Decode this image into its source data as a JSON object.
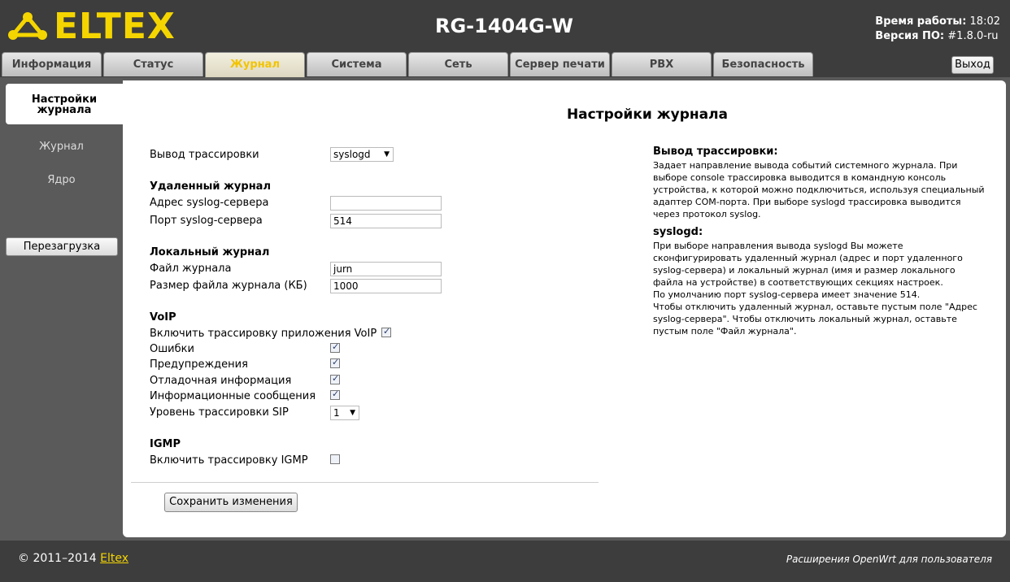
{
  "header": {
    "brand": "ELTEX",
    "device": "RG-1404G-W",
    "uptime_label": "Время работы:",
    "uptime_value": "18:02",
    "firmware_label": "Версия ПО:",
    "firmware_value": "#1.8.0-ru"
  },
  "tabs": [
    {
      "label": "Информация"
    },
    {
      "label": "Статус"
    },
    {
      "label": "Журнал",
      "active": true
    },
    {
      "label": "Система"
    },
    {
      "label": "Сеть"
    },
    {
      "label": "Сервер печати"
    },
    {
      "label": "PBX"
    },
    {
      "label": "Безопасность"
    }
  ],
  "logout_label": "Выход",
  "sidebar": {
    "items": [
      {
        "label": "Настройки журнала",
        "active": true
      },
      {
        "label": "Журнал"
      },
      {
        "label": "Ядро"
      }
    ],
    "reboot_label": "Перезагрузка"
  },
  "page_title": "Настройки журнала",
  "form": {
    "trace_output_label": "Вывод трассировки",
    "trace_output_value": "syslogd",
    "remote_section": "Удаленный журнал",
    "syslog_addr_label": "Адрес syslog-сервера",
    "syslog_addr_value": "",
    "syslog_port_label": "Порт syslog-сервера",
    "syslog_port_value": "514",
    "local_section": "Локальный журнал",
    "log_file_label": "Файл журнала",
    "log_file_value": "jurn",
    "log_size_label": "Размер файла журнала (КБ)",
    "log_size_value": "1000",
    "voip_section": "VoIP",
    "voip_enable_label": "Включить трассировку приложения VoIP",
    "voip_enable": true,
    "errors_label": "Ошибки",
    "errors": true,
    "warnings_label": "Предупреждения",
    "warnings": true,
    "debug_label": "Отладочная информация",
    "debug": true,
    "info_label": "Информационные сообщения",
    "info": true,
    "sip_level_label": "Уровень трассировки SIP",
    "sip_level_value": "1",
    "igmp_section": "IGMP",
    "igmp_enable_label": "Включить трассировку IGMP",
    "igmp_enable": false,
    "save_label": "Сохранить изменения"
  },
  "help": {
    "h1": "Вывод трассировки:",
    "p1": "Задает направление вывода событий системного журнала. При\nвыборе console трассировка выводится в командную консоль\nустройства, к которой можно подключиться, используя специальный\nадаптер COM-порта. При выборе syslogd трассировка выводится\nчерез протокол syslog.",
    "h2": "syslogd:",
    "p2": "При выборе направления вывода syslogd Вы можете\nсконфигурировать удаленный журнал (адрес и порт удаленного\nsyslog-сервера) и локальный журнал (имя и размер локального\nфайла на устройстве) в соответствующих секциях настроек.\nПо умолчанию порт syslog-сервера имеет значение 514.\nЧтобы отключить удаленный журнал, оставьте пустым поле \"Адрес\nsyslog-сервера\". Чтобы отключить локальный журнал, оставьте\nпустым поле \"Файл журнала\"."
  },
  "footer": {
    "copyright": "© 2011–2014 ",
    "link": "Eltex",
    "right": "Расширения OpenWrt для пользователя"
  },
  "colors": {
    "brand_yellow": "#f5d500",
    "header_bg": "#3d3d3d",
    "page_bg": "#5a5a5a"
  }
}
